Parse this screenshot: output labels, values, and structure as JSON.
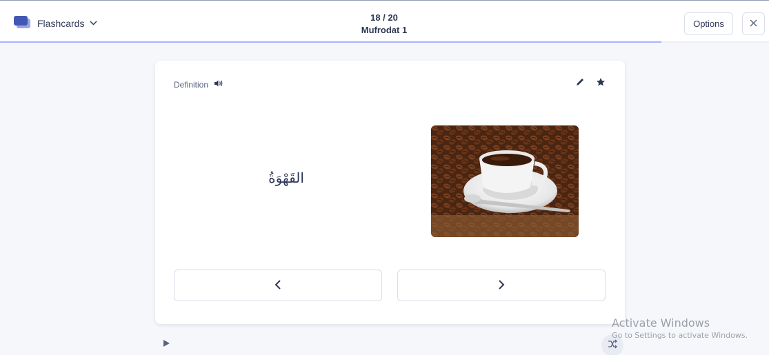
{
  "header": {
    "mode_label": "Flashcards",
    "counter": "18 / 20",
    "set_title": "Mufrodat 1",
    "options_label": "Options",
    "progress_fraction": 0.86
  },
  "card": {
    "side_label": "Definition",
    "term": "القَهْوَةُ"
  },
  "watermark": {
    "title": "Activate Windows",
    "subtitle": "Go to Settings to activate Windows."
  },
  "colors": {
    "brand": "#4257b2",
    "text": "#2e3856",
    "muted": "#586380",
    "background": "#f6f7fb"
  },
  "icons": [
    "flashcards-mode-icon",
    "chevron-down-icon",
    "close-icon",
    "speaker-icon",
    "pencil-icon",
    "star-icon",
    "chevron-left-icon",
    "chevron-right-icon",
    "play-icon",
    "shuffle-icon"
  ]
}
